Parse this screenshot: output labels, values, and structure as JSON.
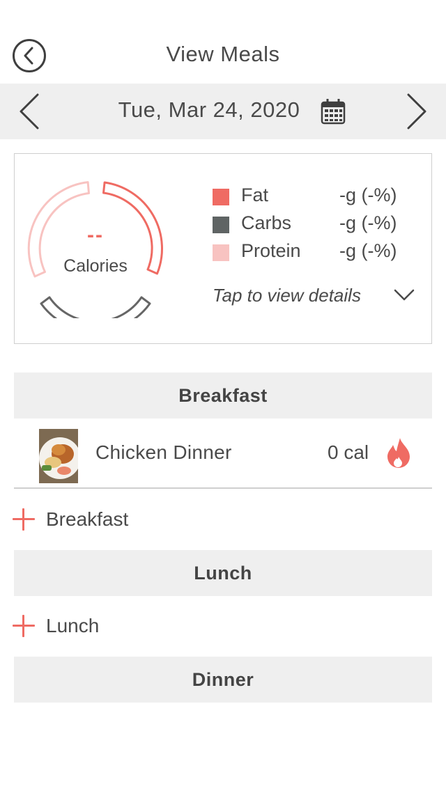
{
  "header": {
    "title": "View Meals",
    "back_icon": "back-circle-icon"
  },
  "date_bar": {
    "date": "Tue, Mar 24, 2020",
    "prev_icon": "chevron-left-icon",
    "next_icon": "chevron-right-icon",
    "calendar_icon": "calendar-icon"
  },
  "summary": {
    "calories_value": "--",
    "calories_label": "Calories",
    "details_label": "Tap to view details",
    "legend": [
      {
        "name": "Fat",
        "value": "-g (-%)",
        "color": "#ef6b63"
      },
      {
        "name": "Carbs",
        "value": "-g (-%)",
        "color": "#5f6464"
      },
      {
        "name": "Protein",
        "value": "-g (-%)",
        "color": "#f8c3c1"
      }
    ]
  },
  "sections": {
    "breakfast": {
      "title": "Breakfast",
      "add_label": "Breakfast"
    },
    "lunch": {
      "title": "Lunch",
      "add_label": "Lunch"
    },
    "dinner": {
      "title": "Dinner"
    }
  },
  "meals": [
    {
      "name": "Chicken Dinner",
      "calories": "0 cal",
      "icon": "fire-icon"
    }
  ],
  "colors": {
    "accent": "#ef6b63",
    "section_bg": "#efefef",
    "text": "#4a4a4a"
  }
}
